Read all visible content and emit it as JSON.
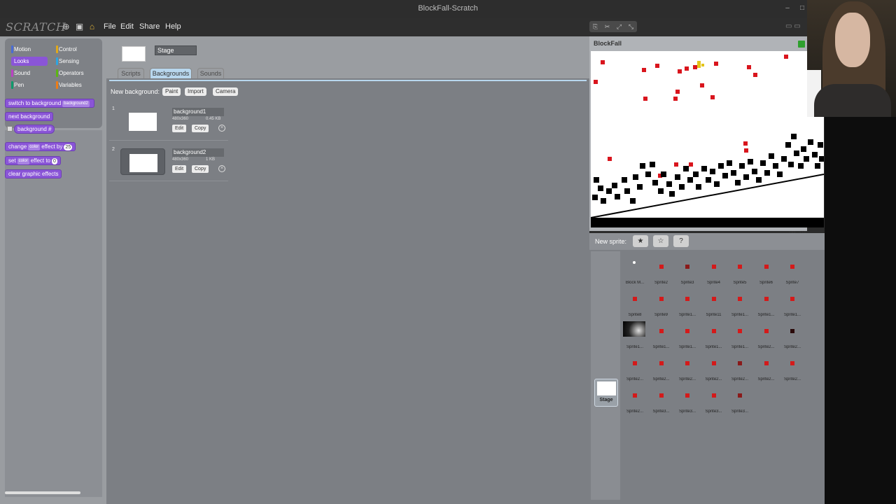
{
  "window": {
    "title": "BlockFall-Scratch"
  },
  "menubar": {
    "logo": "SCRATCH",
    "items": [
      "File",
      "Edit",
      "Share",
      "Help"
    ]
  },
  "palette": {
    "categories": [
      {
        "label": "Motion",
        "color": "#4a6cd4"
      },
      {
        "label": "Control",
        "color": "#e1a91a"
      },
      {
        "label": "Looks",
        "color": "#8a55d7"
      },
      {
        "label": "Sensing",
        "color": "#2ca5e2"
      },
      {
        "label": "Sound",
        "color": "#bb42c3"
      },
      {
        "label": "Operators",
        "color": "#5cb712"
      },
      {
        "label": "Pen",
        "color": "#0e9a6c"
      },
      {
        "label": "Variables",
        "color": "#ee7d16"
      }
    ],
    "blocks": {
      "switch_to": "switch to background",
      "switch_slot": "background2",
      "next": "next background",
      "bg_num": "background #",
      "change": "change",
      "change_slot": "color",
      "change_by": "effect by",
      "change_val": "25",
      "set": "set",
      "set_slot": "color",
      "set_to": "effect to",
      "set_val": "0",
      "clear": "clear graphic effects"
    }
  },
  "editor": {
    "sprite_name": "Stage",
    "tabs": [
      "Scripts",
      "Backgrounds",
      "Sounds"
    ],
    "active_tab": "Backgrounds",
    "new_background_label": "New background:",
    "buttons": [
      "Paint",
      "Import",
      "Camera"
    ],
    "costumes": [
      {
        "index": "1",
        "name": "background1",
        "dims": "480x360",
        "size": "0.45 KB"
      },
      {
        "index": "2",
        "name": "background2",
        "dims": "480x360",
        "size": "1 KB"
      }
    ],
    "edit_label": "Edit",
    "copy_label": "Copy"
  },
  "stage": {
    "title": "BlockFall",
    "mouse_x": "153",
    "mouse_y": "115"
  },
  "sprites": {
    "new_sprite_label": "New sprite:",
    "stage_label": "Stage",
    "items": [
      "Block M...",
      "Sprite2",
      "Sprite3",
      "Sprite4",
      "Sprite5",
      "Sprite6",
      "Sprite7",
      "Sprite8",
      "Sprite9",
      "Sprite1...",
      "Sprite11",
      "Sprite1...",
      "Sprite1...",
      "Sprite1...",
      "Sprite1...",
      "Sprite1...",
      "Sprite1...",
      "Sprite1...",
      "Sprite1...",
      "Sprite2...",
      "Sprite2...",
      "Sprite2...",
      "Sprite2...",
      "Sprite2...",
      "Sprite2...",
      "Sprite2...",
      "Sprite2...",
      "Sprite2...",
      "Sprite2...",
      "Sprite3...",
      "Sprite3...",
      "Sprite3...",
      "Sprite3..."
    ]
  }
}
